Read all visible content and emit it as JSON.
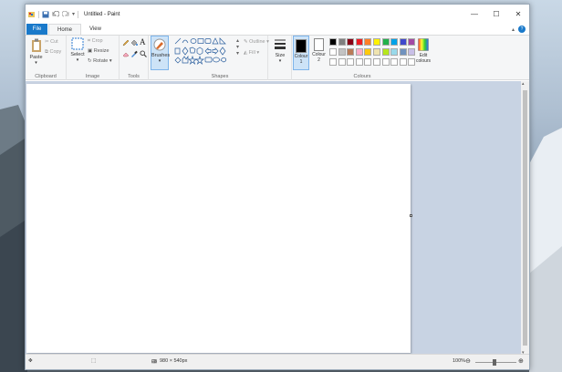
{
  "window": {
    "title": "Untitled - Paint"
  },
  "winbtns": {
    "minimize": "—",
    "maximize": "☐",
    "close": "✕"
  },
  "tabs": {
    "file": "File",
    "home": "Home",
    "view": "View"
  },
  "clipboard": {
    "paste": "Paste",
    "cut": "Cut",
    "copy": "Copy",
    "label": "Clipboard"
  },
  "image": {
    "select": "Select",
    "crop": "Crop",
    "resize": "Resize",
    "rotate": "Rotate",
    "label": "Image"
  },
  "tools": {
    "label": "Tools"
  },
  "brushes": {
    "label": "Brushes"
  },
  "shapes": {
    "outline": "Outline",
    "fill": "Fill",
    "label": "Shapes"
  },
  "size": {
    "label": "Size"
  },
  "colours": {
    "colour1": "Colour 1",
    "colour2": "Colour 2",
    "label": "Colours",
    "edit": "Edit colours",
    "row1": [
      "#000000",
      "#7f7f7f",
      "#880015",
      "#ed1c24",
      "#ff7f27",
      "#fff200",
      "#22b14c",
      "#00a2e8",
      "#3f48cc",
      "#a349a4"
    ],
    "row2": [
      "#ffffff",
      "#c3c3c3",
      "#b97a57",
      "#ffaec9",
      "#ffc90e",
      "#efe4b0",
      "#b5e61d",
      "#99d9ea",
      "#7092be",
      "#c8bfe7"
    ]
  },
  "status": {
    "dimensions": "980 × 540px",
    "zoom": "100%"
  }
}
